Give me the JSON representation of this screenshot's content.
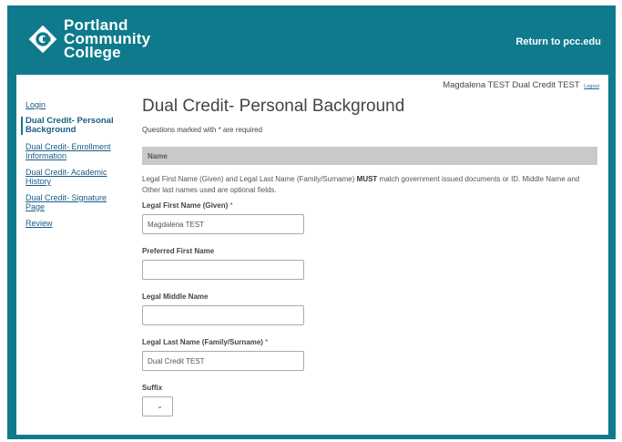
{
  "header": {
    "logo_lines": [
      "Portland",
      "Community",
      "College"
    ],
    "return_link": "Return to pcc.edu"
  },
  "user": {
    "name": "Magdalena TEST Dual Credit TEST",
    "logout": "Logout"
  },
  "sidebar": {
    "items": [
      {
        "label": "Login"
      },
      {
        "label": "Dual Credit- Personal Background"
      },
      {
        "label": "Dual Credit- Enrollment Information"
      },
      {
        "label": "Dual Credit- Academic History"
      },
      {
        "label": "Dual Credit- Signature Page"
      },
      {
        "label": "Review"
      }
    ]
  },
  "main": {
    "title": "Dual Credit- Personal Background",
    "required_note": "Questions marked with * are required",
    "section_name": "Name",
    "intro_before": "Legal First Name (Given) and Legal Last Name (Family/Surname) ",
    "intro_bold": "MUST",
    "intro_after": " match government issued documents or ID. Middle Name and Other last names used are optional fields.",
    "fields": {
      "first_name": {
        "label": "Legal First Name (Given)",
        "required": "*",
        "value": "Magdalena TEST"
      },
      "preferred_name": {
        "label": "Preferred First Name",
        "value": ""
      },
      "middle_name": {
        "label": "Legal Middle Name",
        "value": ""
      },
      "last_name": {
        "label": "Legal Last Name (Family/Surname)",
        "required": "*",
        "value": "Dual Credit TEST"
      },
      "suffix": {
        "label": "Suffix",
        "value": ""
      }
    }
  },
  "colors": {
    "brand_teal": "#0e7a8c",
    "section_gray": "#c9c9c9"
  }
}
